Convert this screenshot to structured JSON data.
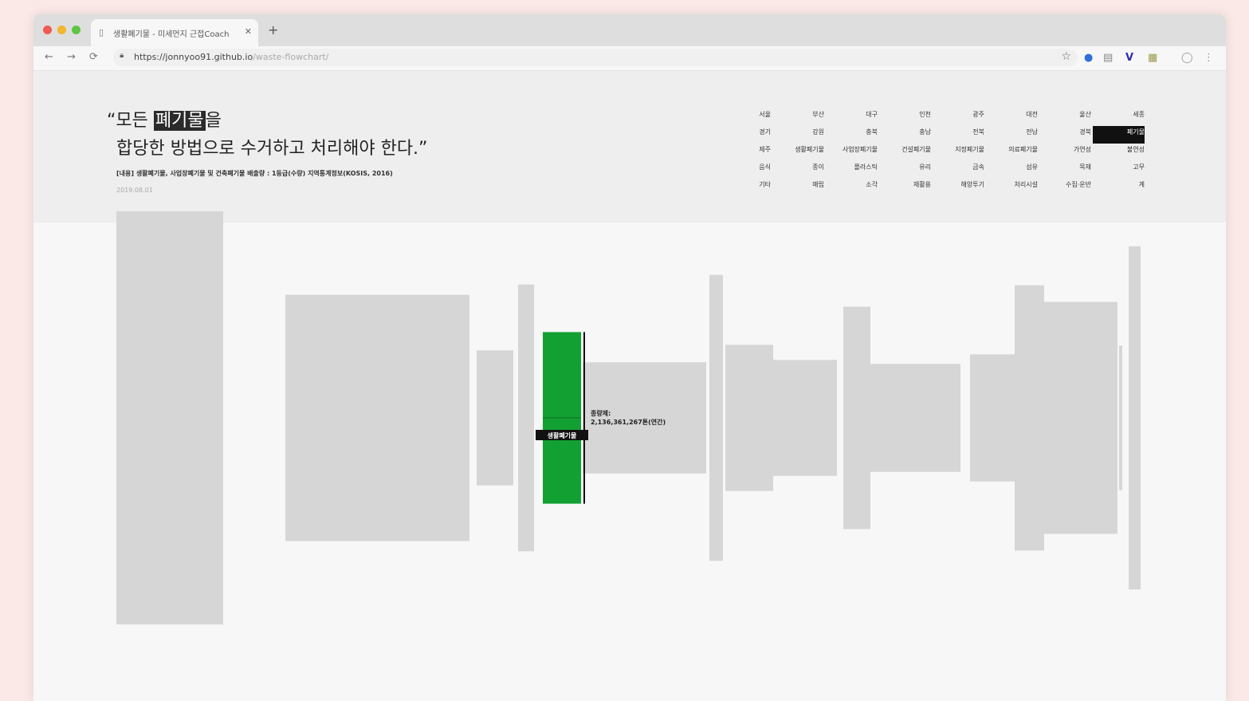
{
  "browser": {
    "tab_icon": "document-icon",
    "tab_title": "생활폐기물 - 미세먼지 근접Coach",
    "tab_close": "✕",
    "new_tab": "+",
    "back": "←",
    "forward": "→",
    "reload": "⟳",
    "url_host": "https://jonnyoo91.github.io",
    "url_path": "/waste-flowchart/",
    "bookmark": "☆"
  },
  "hero": {
    "quote_open": "“모든 ",
    "quote_highlight": "폐기물",
    "quote_after": "을",
    "quote_line2": "합당한 방법으로 수거하고 처리해야 한다.”",
    "source": "[내용] 생활폐기물, 사업장폐기물 및 건축폐기물 배출량 : 1등급(수량) 지역통계정보(KOSIS, 2016)",
    "date": "2019.08.01"
  },
  "categories": [
    "서울",
    "부산",
    "대구",
    "인천",
    "광주",
    "대전",
    "울산",
    "세종",
    "경기",
    "강원",
    "충북",
    "충남",
    "전북",
    "전남",
    "경북",
    "폐기물",
    "제주",
    "생활폐기물",
    "사업장폐기물",
    "건설폐기물",
    "지정폐기물",
    "의료폐기물",
    "가연성",
    "불연성",
    "음식",
    "종이",
    "플라스틱",
    "유리",
    "금속",
    "섬유",
    "목재",
    "고무",
    "기타",
    "매립",
    "소각",
    "재활용",
    "해양투기",
    "처리시설",
    "수집·운반",
    "계"
  ],
  "active_category_index": 15,
  "chart_data": {
    "type": "bar",
    "values": [
      260,
      155,
      85,
      168,
      108,
      70,
      180,
      92,
      73,
      140,
      68,
      80,
      167,
      146,
      91,
      216
    ],
    "highlight_index": 4,
    "highlight_label": "생활폐기물",
    "annotation_line1": "종량제:",
    "annotation_line2": "2,136,361,267톤(연간)"
  },
  "colors": {
    "highlight": "#12a033",
    "bar": "#d6d6d6"
  }
}
